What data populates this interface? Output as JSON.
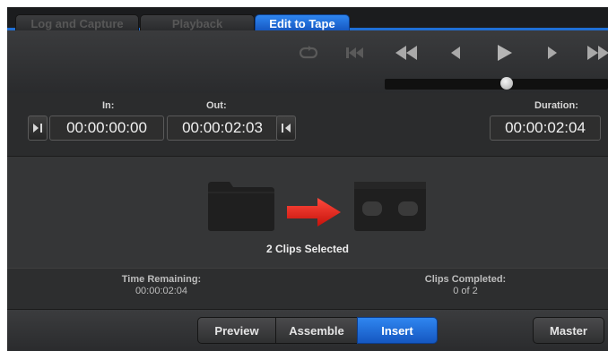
{
  "tabs": [
    {
      "label": "Log and Capture",
      "active": false
    },
    {
      "label": "Playback",
      "active": false
    },
    {
      "label": "Edit to Tape",
      "active": true
    }
  ],
  "transport": {
    "buttons": [
      "loop-icon",
      "go-to-start-icon",
      "rewind-icon",
      "step-back-icon",
      "play-icon",
      "step-forward-icon",
      "fast-forward-icon"
    ],
    "jog_position": 0.55
  },
  "timecode": {
    "in_label": "In:",
    "in_value": "00:00:00:00",
    "out_label": "Out:",
    "out_value": "00:00:02:03",
    "duration_label": "Duration:",
    "duration_value": "00:00:02:04"
  },
  "main": {
    "selection_text": "2 Clips Selected",
    "icons": [
      "folder-icon",
      "arrow-right-icon",
      "tape-icon"
    ]
  },
  "status": {
    "time_remaining_label": "Time Remaining:",
    "time_remaining_value": "00:00:02:04",
    "clips_completed_label": "Clips Completed:",
    "clips_completed_value": "0 of 2"
  },
  "bottom": {
    "preview_label": "Preview",
    "assemble_label": "Assemble",
    "insert_label": "Insert",
    "master_label": "Master",
    "active_mode": "Insert"
  },
  "colors": {
    "accent": "#1f6fd6",
    "arrow": "#e0231c"
  }
}
